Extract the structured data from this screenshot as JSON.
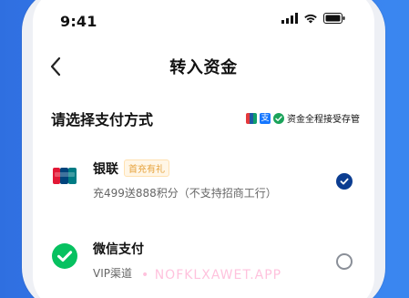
{
  "status_bar": {
    "time": "9:41"
  },
  "nav": {
    "title": "转入资金"
  },
  "section": {
    "title": "请选择支付方式",
    "safety_badge": "资金全程接受存管"
  },
  "payment_options": [
    {
      "name": "银联",
      "tag": "首充有礼",
      "description": "充499送888积分（不支持招商工行）",
      "selected": true
    },
    {
      "name": "微信支付",
      "tag": "",
      "description": "VIP渠道",
      "selected": false
    }
  ],
  "watermark": "• NOFKLXAWET.APP",
  "colors": {
    "accent": "#0b3d91",
    "tag_text": "#e6a23c",
    "tag_bg": "#fff6e6",
    "background_blue": "#3b82f6"
  },
  "icons": {
    "back": "chevron-left-icon",
    "signal": "signal-icon",
    "wifi": "wifi-icon",
    "battery": "battery-icon",
    "unionpay": "unionpay-logo",
    "wechat": "wechat-pay-logo",
    "safe_check": "check-shield-icon"
  }
}
